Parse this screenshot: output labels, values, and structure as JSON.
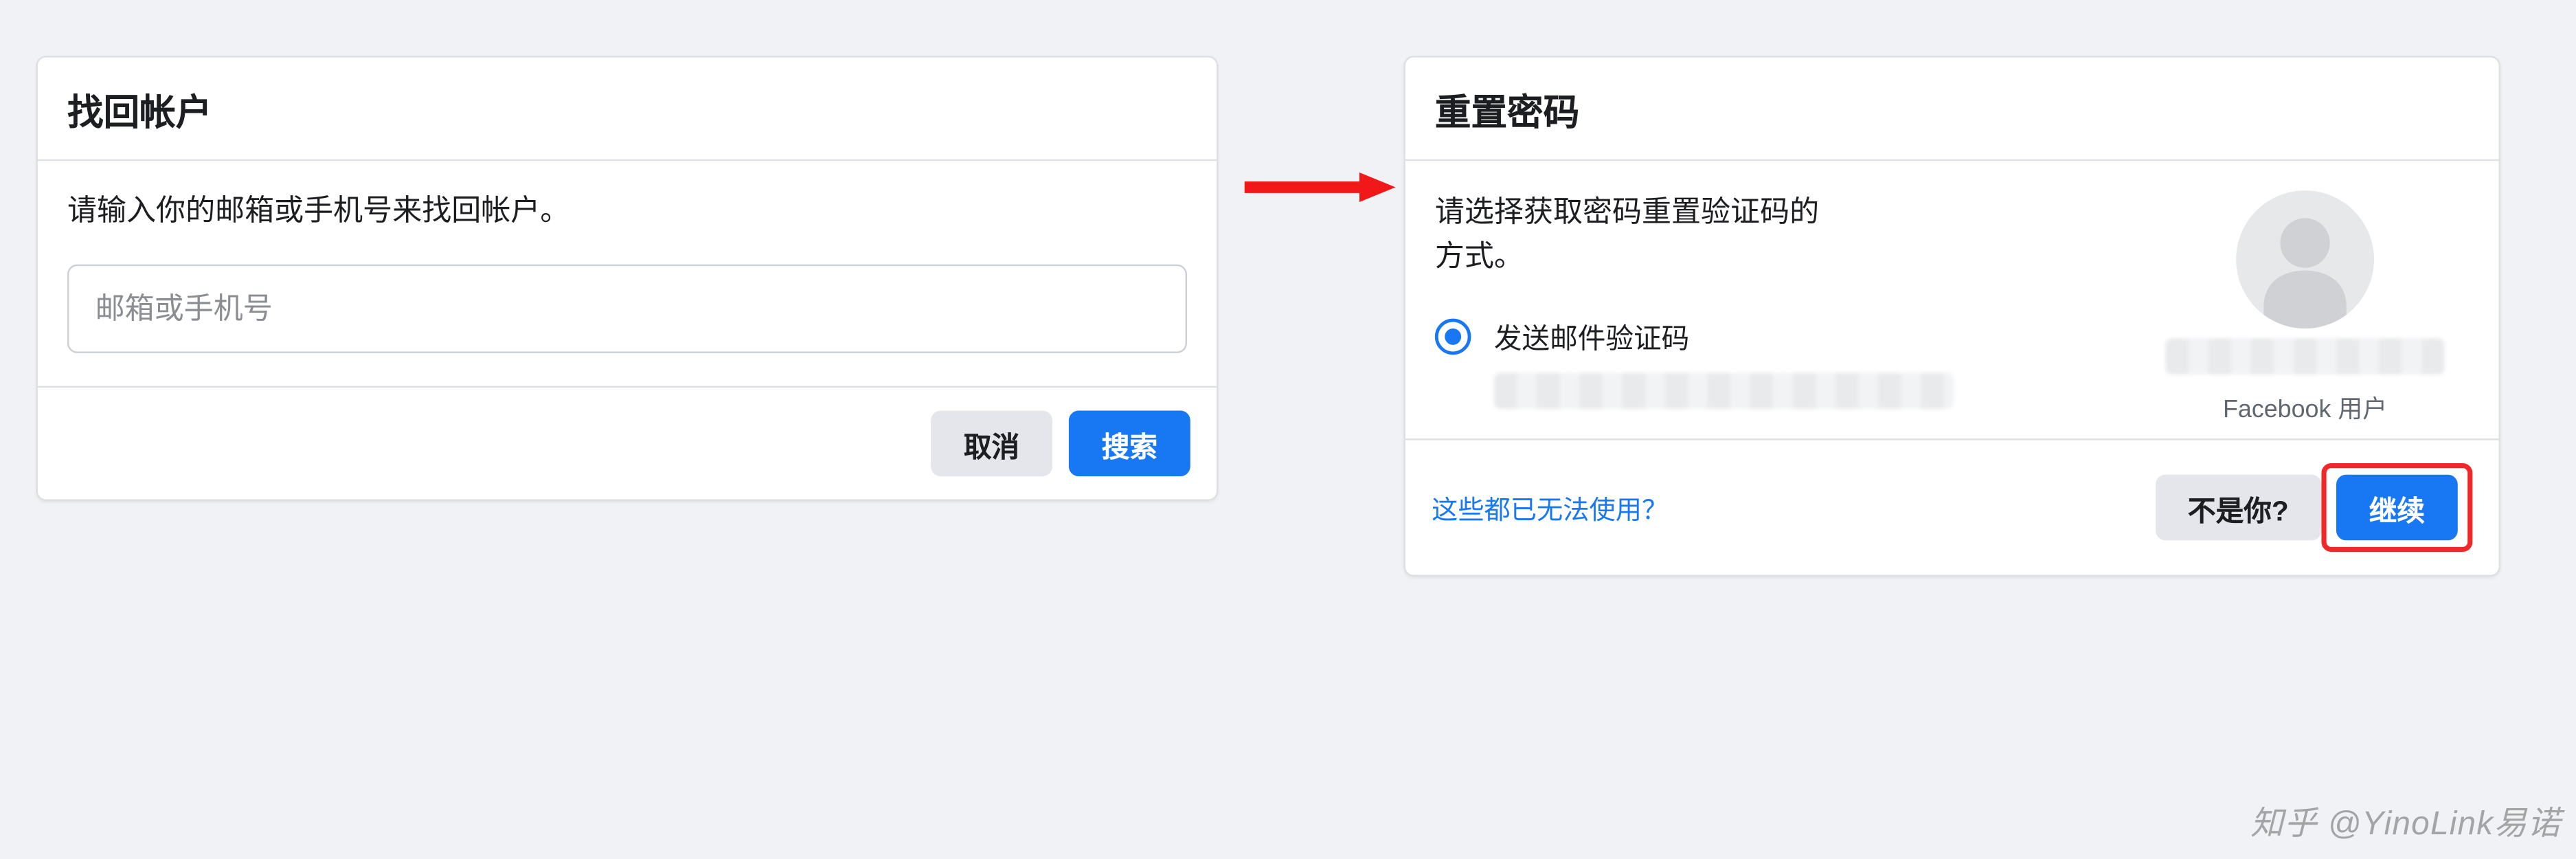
{
  "find": {
    "title": "找回帐户",
    "instruction": "请输入你的邮箱或手机号来找回帐户。",
    "placeholder": "邮箱或手机号",
    "cancel": "取消",
    "search": "搜索"
  },
  "reset": {
    "title": "重置密码",
    "instruction": "请选择获取密码重置验证码的方式。",
    "option_email": "发送邮件验证码",
    "user_sub": "Facebook 用户",
    "no_access_link": "这些都已无法使用？",
    "not_you": "不是你?",
    "continue": "继续"
  },
  "watermark": "知乎 @YinoLink易诺"
}
